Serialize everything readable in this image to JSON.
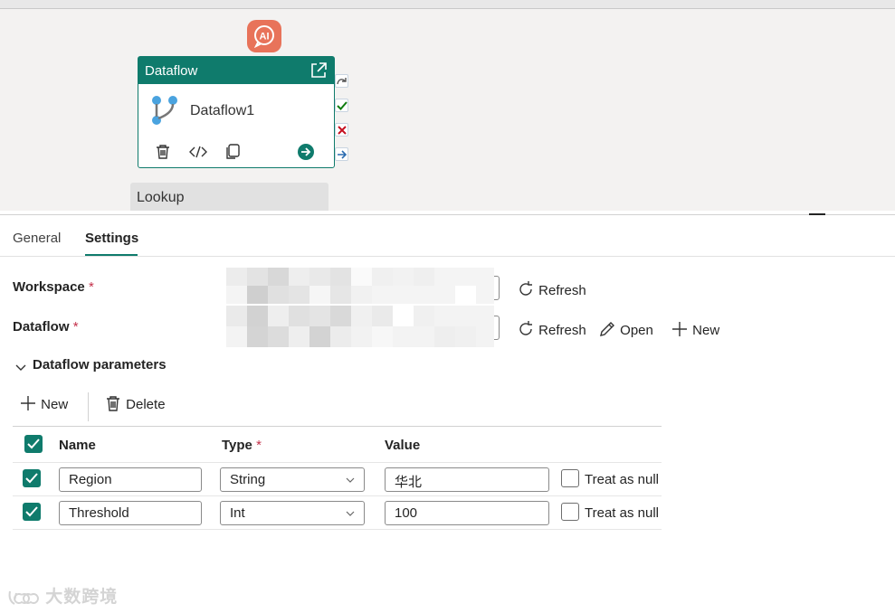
{
  "canvas": {
    "activity": {
      "type_label": "Dataflow",
      "name": "Dataflow1",
      "open_icon": "open-external-icon",
      "icons": [
        "dataflow-icon",
        "delete-icon",
        "code-icon",
        "copy-icon",
        "go-arrow-icon"
      ]
    },
    "ai_badge": "AI",
    "next_activity": "Lookup",
    "side_icons": [
      "skip-icon",
      "success-icon",
      "fail-icon",
      "completion-icon"
    ]
  },
  "tabs": [
    {
      "label": "General",
      "active": false
    },
    {
      "label": "Settings",
      "active": true
    }
  ],
  "settings": {
    "workspace": {
      "label": "Workspace",
      "required": "*",
      "refresh_label": "Refresh"
    },
    "dataflow": {
      "label": "Dataflow",
      "required": "*",
      "refresh_label": "Refresh",
      "open_label": "Open",
      "new_label": "New"
    },
    "parameters": {
      "title": "Dataflow parameters",
      "new_label": "New",
      "delete_label": "Delete",
      "columns": {
        "name": "Name",
        "type": "Type",
        "type_required": "*",
        "value": "Value"
      },
      "rows": [
        {
          "checked": true,
          "name": "Region",
          "type": "String",
          "value": "华北",
          "null_label": "Treat as null"
        },
        {
          "checked": true,
          "name": "Threshold",
          "type": "Int",
          "value": "100",
          "null_label": "Treat as null"
        }
      ]
    }
  },
  "watermark": "大数跨境",
  "colors": {
    "accent": "#0f7b6c",
    "ai_badge": "#e8735a",
    "required": "#c4314b",
    "fail": "#c50f1f",
    "success": "#107c10"
  }
}
